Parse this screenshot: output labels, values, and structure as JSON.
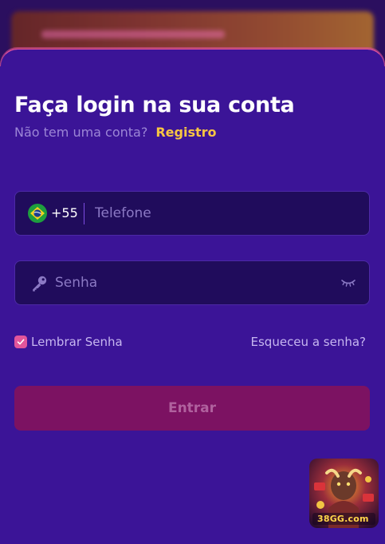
{
  "page": {
    "title": "Faça login na sua conta",
    "subtitle": "Não tem uma conta?",
    "register_link": "Registro"
  },
  "phone_field": {
    "flag_icon": "brazil-flag-icon",
    "country_code": "+55",
    "placeholder": "Telefone",
    "value": ""
  },
  "password_field": {
    "leading_icon": "key-icon",
    "placeholder": "Senha",
    "value": "",
    "trailing_icon": "eye-closed-icon"
  },
  "remember": {
    "label": "Lembrar Senha",
    "checked": true
  },
  "forgot_link": "Esqueceu a senha?",
  "submit": {
    "label": "Entrar"
  },
  "promo_badge": {
    "logo_text": "38GG.com"
  },
  "colors": {
    "sheet_background": "#3b1497",
    "input_background": "#200c5c",
    "accent_yellow": "#f7c542",
    "accent_pink": "#e2559b",
    "button_background": "#7c1262",
    "muted_text": "#9c86d6"
  }
}
